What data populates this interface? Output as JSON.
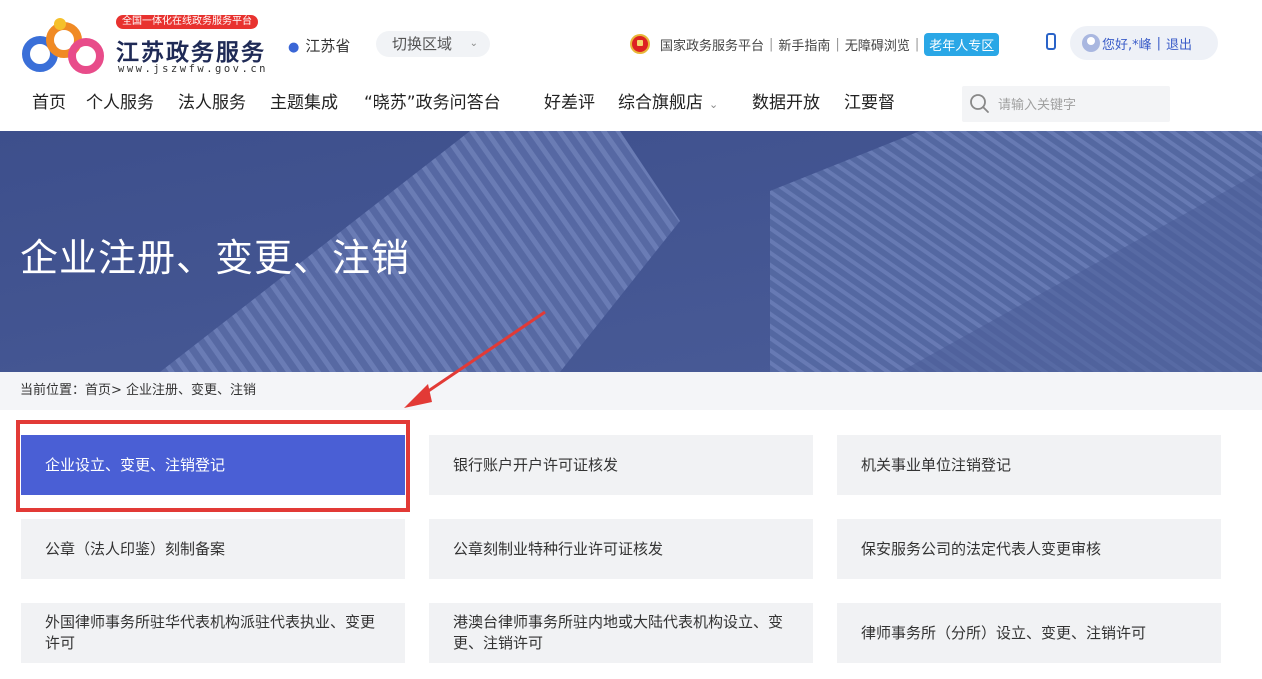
{
  "header": {
    "slogan": "全国一体化在线政务服务平台",
    "site_name": "江苏政务服务",
    "site_url": "www.jszwfw.gov.cn",
    "location": "江苏省",
    "region_switch": "切换区域",
    "links": {
      "national_platform": "国家政务服务平台",
      "guide": "新手指南",
      "accessible": "无障碍浏览",
      "elder_zone": "老年人专区"
    },
    "user_greeting": "您好,*峰",
    "logout": "退出"
  },
  "nav": {
    "items": [
      "首页",
      "个人服务",
      "法人服务",
      "主题集成",
      "“晓苏”政务问答台",
      "好差评",
      "综合旗舰店",
      "数据开放",
      "江要督"
    ],
    "search_placeholder": "请输入关键字"
  },
  "banner": {
    "title": "企业注册、变更、注销"
  },
  "breadcrumb": {
    "label": "当前位置：",
    "home": "首页>",
    "current": " 企业注册、变更、注销"
  },
  "services": [
    "企业设立、变更、注销登记",
    "银行账户开户许可证核发",
    "机关事业单位注销登记",
    "公章（法人印鉴）刻制备案",
    "公章刻制业特种行业许可证核发",
    "保安服务公司的法定代表人变更审核",
    "外国律师事务所驻华代表机构派驻代表执业、变更许可",
    "港澳台律师事务所驻内地或大陆代表机构设立、变更、注销许可",
    "律师事务所（分所）设立、变更、注销许可"
  ],
  "colors": {
    "brand_blue": "#4a5fd5",
    "banner_bg": "#43548f",
    "highlight_red": "#e23a36",
    "elder_badge": "#2aa7e6"
  }
}
